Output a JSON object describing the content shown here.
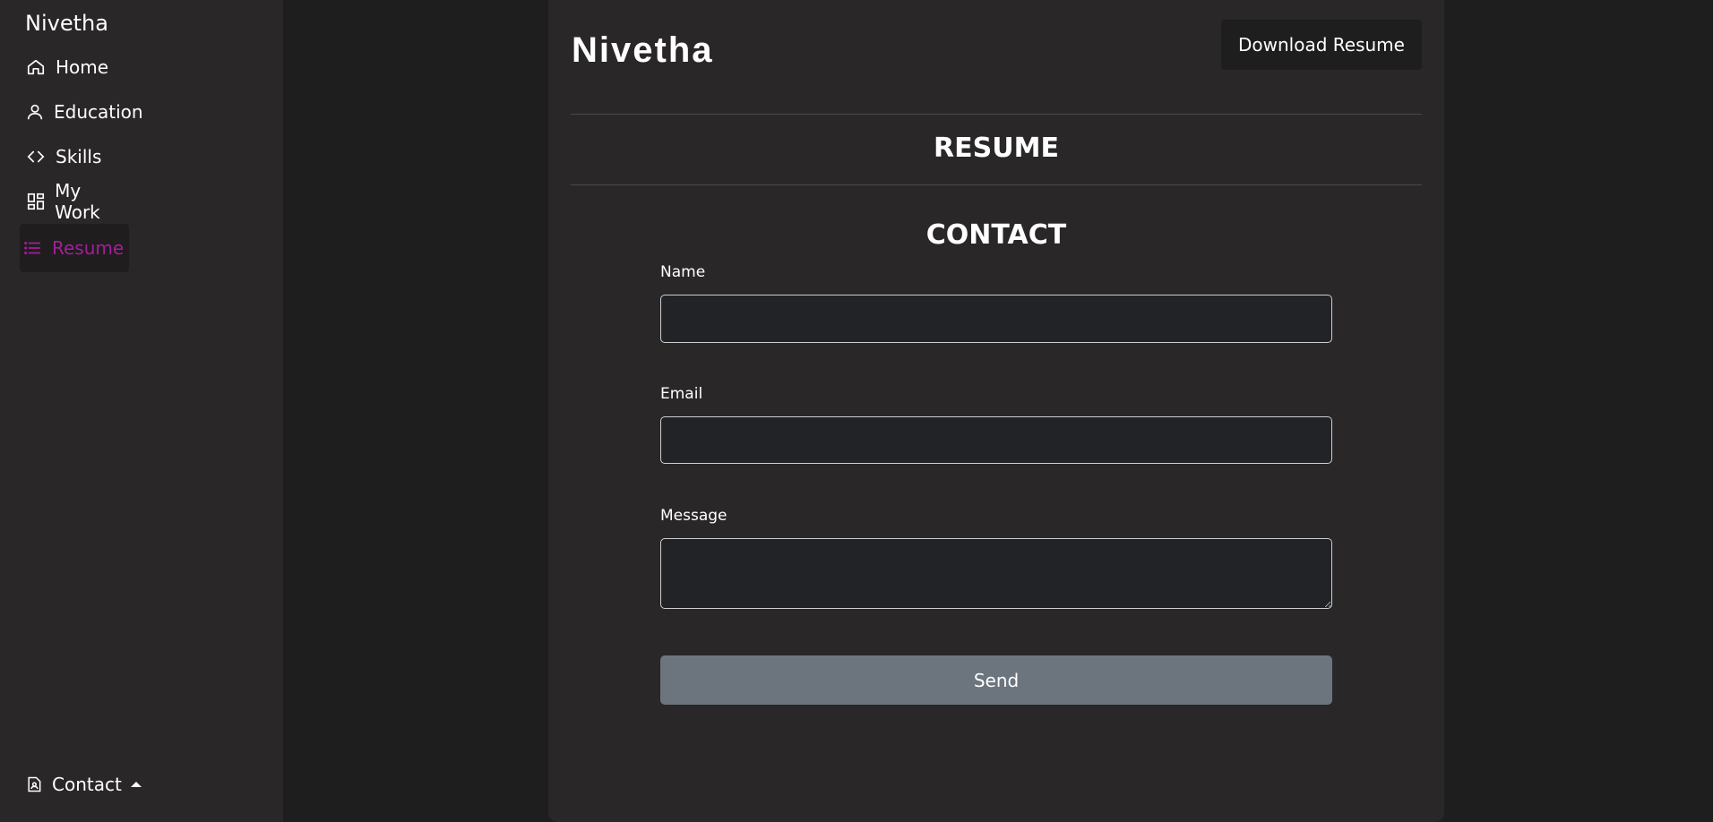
{
  "sidebar": {
    "brand": "Nivetha",
    "items": [
      {
        "label": "Home",
        "icon": "home-icon"
      },
      {
        "label": "Education",
        "icon": "person-icon"
      },
      {
        "label": "Skills",
        "icon": "code-icon"
      },
      {
        "label": "My Work",
        "icon": "dashboard-icon"
      },
      {
        "label": "Resume",
        "icon": "list-icon",
        "active": true
      }
    ],
    "contact": {
      "label": "Contact",
      "icon": "contact-card-icon",
      "caret": "caret-up-icon"
    }
  },
  "main": {
    "title": "Nivetha",
    "download_label": "Download Resume",
    "resume_heading": "RESUME",
    "contact_heading": "CONTACT",
    "form": {
      "name_label": "Name",
      "name_value": "",
      "email_label": "Email",
      "email_value": "",
      "message_label": "Message",
      "message_value": "",
      "send_label": "Send"
    }
  },
  "colors": {
    "accent": "#a51d9c",
    "background": "#1e1e1e",
    "panel": "#292728",
    "button_gray": "#6c757d"
  }
}
